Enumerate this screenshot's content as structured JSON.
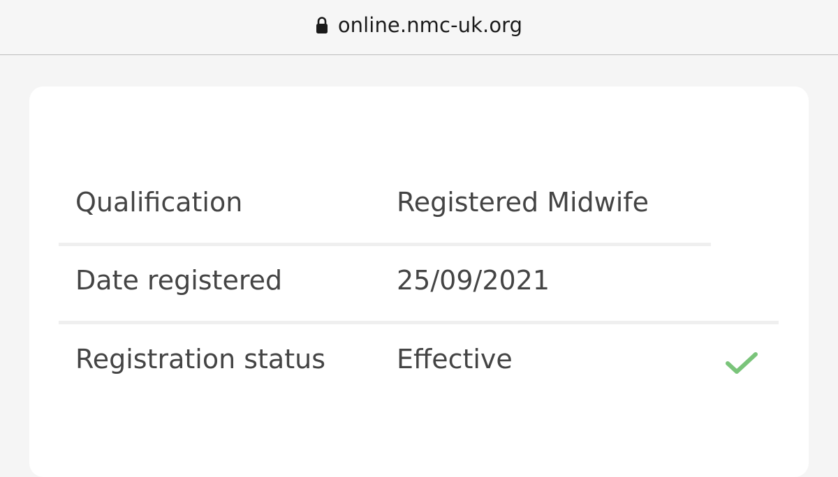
{
  "browser": {
    "url": "online.nmc-uk.org",
    "lock_icon": "lock-icon"
  },
  "registration": {
    "rows": [
      {
        "label": "Qualification",
        "value": "Registered Midwife"
      },
      {
        "label": "Date registered",
        "value": "25/09/2021"
      },
      {
        "label": "Registration status",
        "value": "Effective",
        "status_icon": "checkmark-icon"
      }
    ]
  },
  "colors": {
    "text": "#444444",
    "divider": "#efefef",
    "check": "#7ac47a",
    "page_background": "#f5f5f5",
    "card_background": "#ffffff"
  }
}
